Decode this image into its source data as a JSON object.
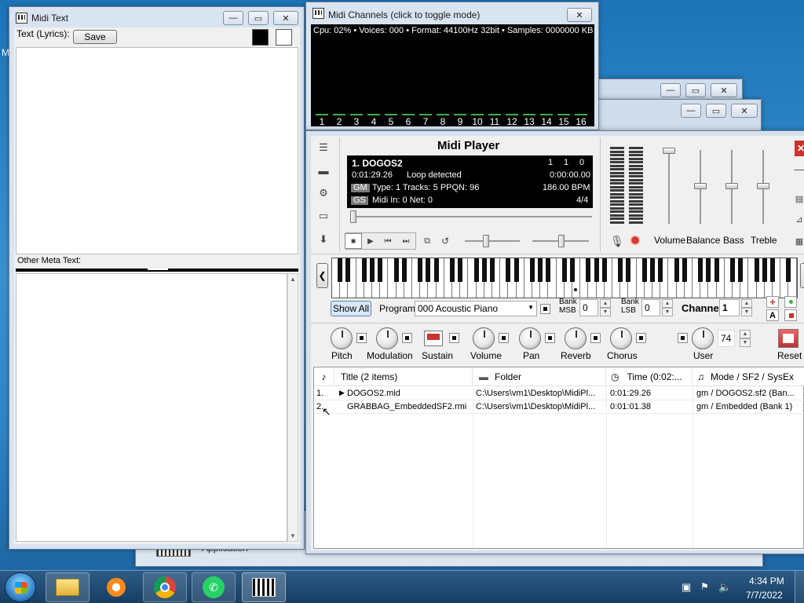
{
  "desktop": {
    "edge_label": "M"
  },
  "midi_text_window": {
    "title": "Midi Text",
    "lyrics_label": "Text (Lyrics):",
    "save_label": "Save",
    "colors": [
      "#000000",
      "#ffffff"
    ],
    "other_meta_label": "Other Meta Text:"
  },
  "midi_channels_window": {
    "title": "Midi Channels (click to toggle mode)",
    "status": "Cpu: 02% • Voices: 000 • Format: 44100Hz 32bit • Samples: 0000000 KB",
    "channels": [
      "1",
      "2",
      "3",
      "4",
      "5",
      "6",
      "7",
      "8",
      "9",
      "10",
      "11",
      "12",
      "13",
      "14",
      "15",
      "16"
    ]
  },
  "player": {
    "title": "Midi Player",
    "lcd": {
      "song": "1. DOGOS2",
      "counters": [
        "1",
        "1",
        "0"
      ],
      "time": "0:01:29.26",
      "loop": "Loop detected",
      "elapsed": "0:00:00.00",
      "gm": "GM",
      "gs": "GS",
      "type_info": "Type: 1  Tracks: 5  PPQN: 96",
      "bpm": "186.00 BPM",
      "midi_in": "Midi In: 0  Net: 0",
      "signature": "4/4"
    },
    "mixer_labels": {
      "volume": "Volume",
      "balance": "Balance",
      "bass": "Bass",
      "treble": "Treble"
    },
    "controls": {
      "show_all": "Show All",
      "program_label": "Program",
      "program_value": "000 Acoustic Piano",
      "bank_msb_label": "Bank MSB",
      "bank_msb_value": "0",
      "bank_lsb_label": "Bank LSB",
      "bank_lsb_value": "0",
      "channel_label": "Channel",
      "channel_value": "1",
      "a_label": "A"
    },
    "knobs": {
      "pitch": "Pitch",
      "modulation": "Modulation",
      "sustain": "Sustain",
      "volume": "Volume",
      "pan": "Pan",
      "reverb": "Reverb",
      "chorus": "Chorus",
      "user": "User",
      "user_value": "74",
      "reset": "Reset"
    },
    "playlist": {
      "headers": {
        "title": "Title (2 items)",
        "folder": "Folder",
        "time": "Time (0:02:...",
        "mode": "Mode / SF2 / SysEx"
      },
      "rows": [
        {
          "num": "1.",
          "title": "DOGOS2.mid",
          "folder": "C:\\Users\\vm1\\Desktop\\MidiPl...",
          "time": "0:01:29.26",
          "mode": "gm / DOGOS2.sf2 (Ban..."
        },
        {
          "num": "2.",
          "title": "GRABBAG_EmbeddedSF2.rmi",
          "folder": "C:\\Users\\vm1\\Desktop\\MidiPl...",
          "time": "0:01:01.38",
          "mode": "gm / Embedded (Bank 1)"
        }
      ]
    }
  },
  "background_window": {
    "label": "Application"
  },
  "taskbar": {
    "time": "4:34 PM",
    "date": "7/7/2022"
  }
}
